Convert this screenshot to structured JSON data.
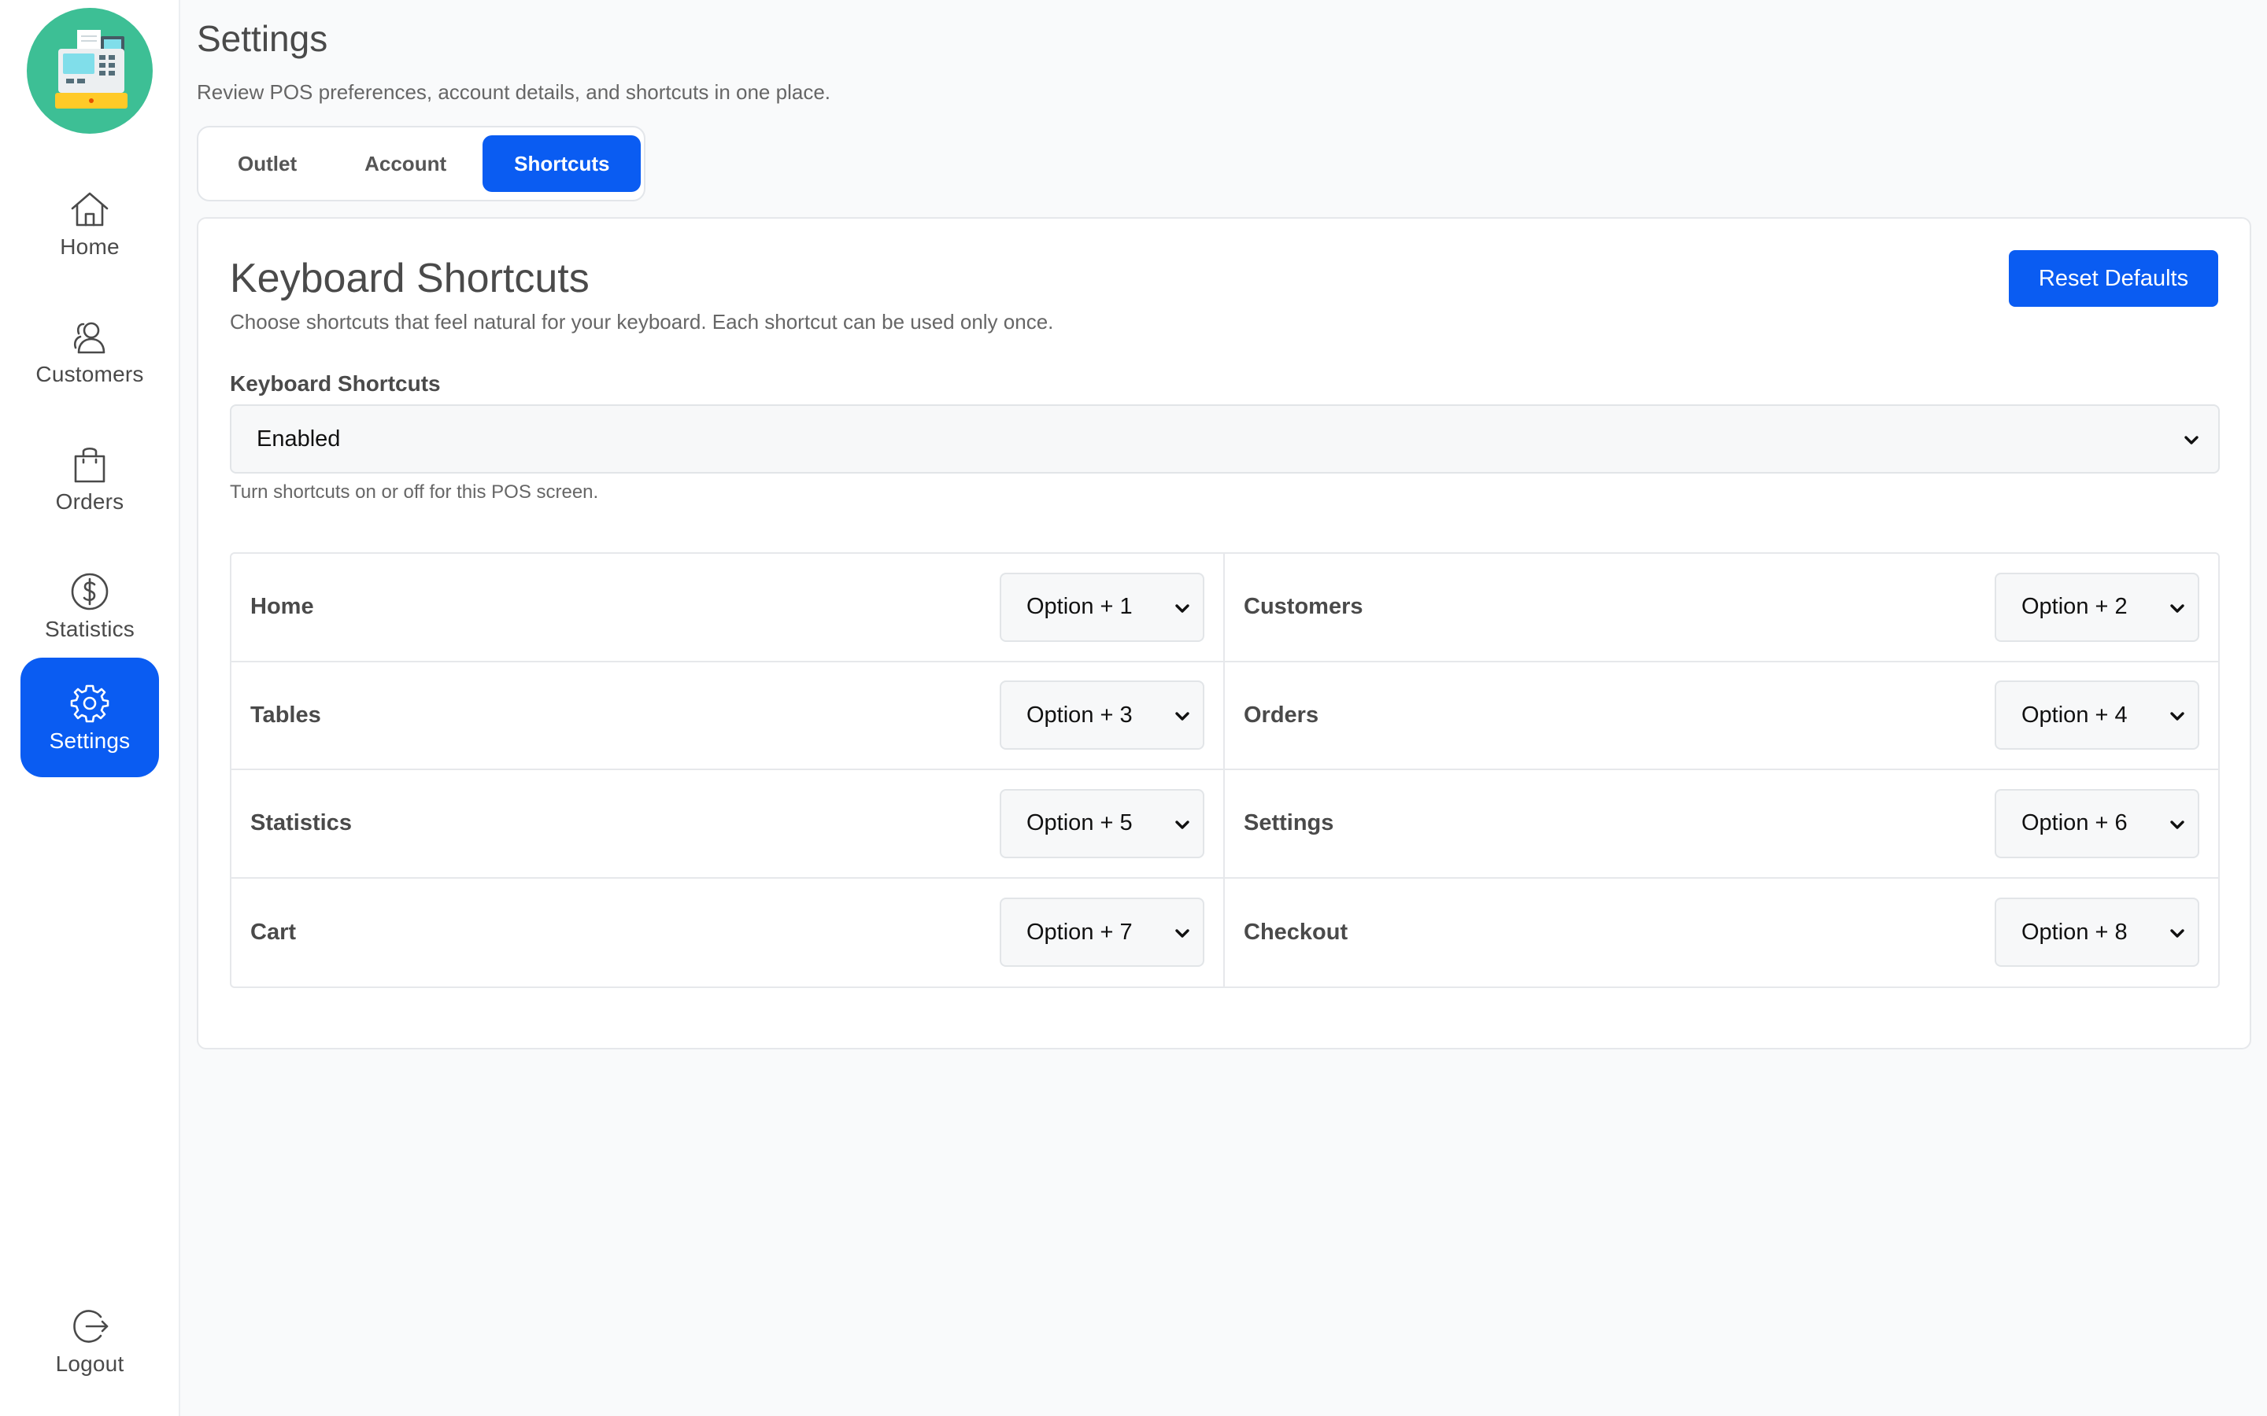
{
  "colors": {
    "accent": "#0a5cf2",
    "logo_bg": "#3dbf95",
    "page_bg": "#f9fafb"
  },
  "sidebar": {
    "logo_icon": "cash-register-icon",
    "items": [
      {
        "label": "Home",
        "icon": "home-icon",
        "active": false
      },
      {
        "label": "Customers",
        "icon": "users-icon",
        "active": false
      },
      {
        "label": "Orders",
        "icon": "bag-icon",
        "active": false
      },
      {
        "label": "Statistics",
        "icon": "dollar-circle-icon",
        "active": false
      },
      {
        "label": "Settings",
        "icon": "gear-icon",
        "active": true
      }
    ],
    "logout": {
      "label": "Logout",
      "icon": "logout-icon"
    }
  },
  "header": {
    "title": "Settings",
    "subtitle": "Review POS preferences, account details, and shortcuts in one place."
  },
  "tabs": [
    {
      "label": "Outlet",
      "active": false
    },
    {
      "label": "Account",
      "active": false
    },
    {
      "label": "Shortcuts",
      "active": true
    }
  ],
  "card": {
    "title": "Keyboard Shortcuts",
    "description": "Choose shortcuts that feel natural for your keyboard. Each shortcut can be used only once.",
    "reset_label": "Reset Defaults",
    "toggle": {
      "label": "Keyboard Shortcuts",
      "value": "Enabled",
      "hint": "Turn shortcuts on or off for this POS screen."
    },
    "shortcuts": [
      {
        "label": "Home",
        "value": "Option + 1"
      },
      {
        "label": "Customers",
        "value": "Option + 2"
      },
      {
        "label": "Tables",
        "value": "Option + 3"
      },
      {
        "label": "Orders",
        "value": "Option + 4"
      },
      {
        "label": "Statistics",
        "value": "Option + 5"
      },
      {
        "label": "Settings",
        "value": "Option + 6"
      },
      {
        "label": "Cart",
        "value": "Option + 7"
      },
      {
        "label": "Checkout",
        "value": "Option + 8"
      }
    ]
  }
}
